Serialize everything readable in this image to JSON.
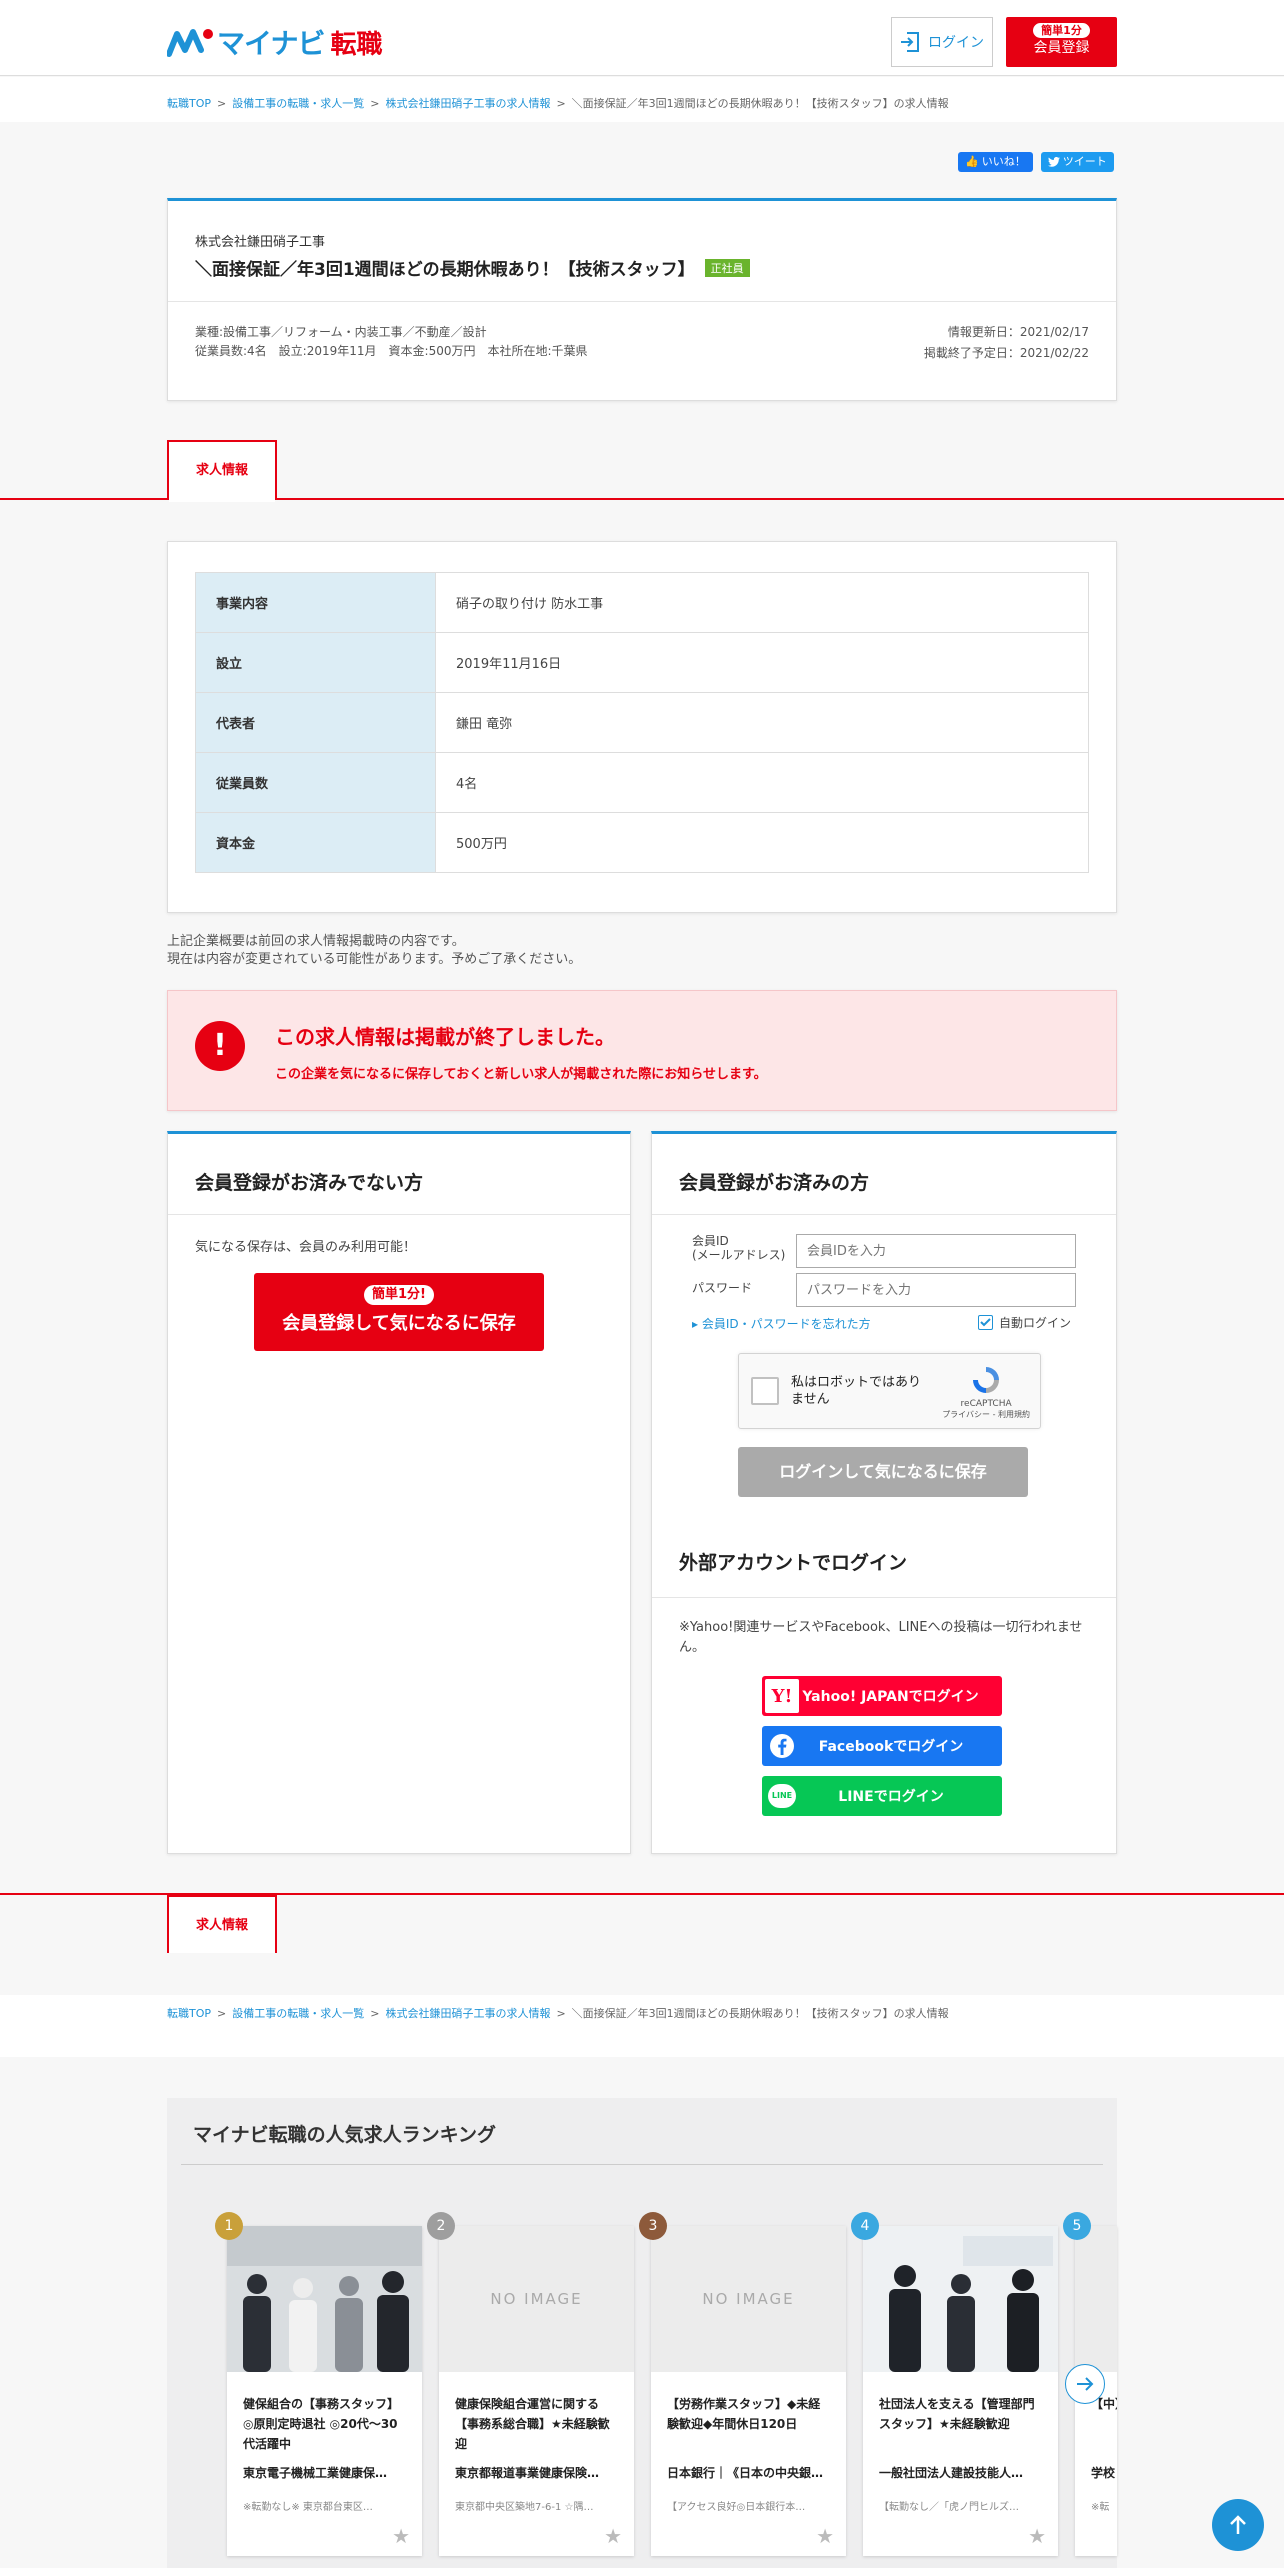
{
  "header": {
    "logo_text": "マイナビ",
    "logo_sub": "転職",
    "login_label": "ログイン",
    "register_pill": "簡単1分",
    "register_label": "会員登録"
  },
  "breadcrumb": {
    "items": [
      "転職TOP",
      "設備工事の転職・求人一覧",
      "株式会社鎌田硝子工事の求人情報"
    ],
    "current": "＼面接保証／年3回1週間ほどの長期休暇あり！【技術スタッフ】の求人情報",
    "sep": ">"
  },
  "social": {
    "like": "いいね！",
    "tweet": "ツイート"
  },
  "job": {
    "company": "株式会社鎌田硝子工事",
    "title": "＼面接保証／年3回1週間ほどの長期休暇あり！【技術スタッフ】",
    "badge": "正社員",
    "meta_line1": "業種:設備工事／リフォーム・内装工事／不動産／設計",
    "meta_line2": "従業員数:4名　設立:2019年11月　資本金:500万円　本社所在地:千葉県",
    "updated": "情報更新日：2021/02/17",
    "end_date": "掲載終了予定日：2021/02/22"
  },
  "tab": {
    "label": "求人情報"
  },
  "info": {
    "rows": [
      {
        "k": "事業内容",
        "v": "硝子の取り付け 防水工事"
      },
      {
        "k": "設立",
        "v": "2019年11月16日"
      },
      {
        "k": "代表者",
        "v": "鎌田 竜弥"
      },
      {
        "k": "従業員数",
        "v": "4名"
      },
      {
        "k": "資本金",
        "v": "500万円"
      }
    ]
  },
  "note": {
    "line1": "上記企業概要は前回の求人情報掲載時の内容です。",
    "line2": "現在は内容が変更されている可能性があります。予めご了承ください。"
  },
  "alert": {
    "icon": "!",
    "title": "この求人情報は掲載が終了しました。",
    "sub": "この企業を気になるに保存しておくと新しい求人が掲載された際にお知らせします。"
  },
  "left_panel": {
    "heading": "会員登録がお済みでない方",
    "text": "気になる保存は、会員のみ利用可能！",
    "btn_pill": "簡単1分!",
    "btn_label": "会員登録して気になるに保存"
  },
  "right_panel": {
    "heading": "会員登録がお済みの方",
    "id_label_1": "会員ID",
    "id_label_2": "(メールアドレス)",
    "id_placeholder": "会員IDを入力",
    "pw_label": "パスワード",
    "pw_placeholder": "パスワードを入力",
    "forgot": "▸ 会員ID・パスワードを忘れた方",
    "auto_login": "自動ログイン",
    "captcha_text_1": "私はロボットではあり",
    "captcha_text_2": "ません",
    "captcha_brand": "reCAPTCHA",
    "captcha_links": "プライバシー - 利用規約",
    "login_btn": "ログインして気になるに保存",
    "ext_heading": "外部アカウントでログイン",
    "ext_note": "※Yahoo!関連サービスやFacebook、LINEへの投稿は一切行われません。",
    "yahoo": "Yahoo! JAPANでログイン",
    "facebook": "Facebookでログイン",
    "line": "LINEでログイン",
    "line_icon_text": "LINE"
  },
  "colors": {
    "brand_blue": "#1e92d6",
    "brand_red": "#e60012",
    "yahoo": "#ff0033",
    "facebook": "#1877f2",
    "line": "#06c755"
  },
  "ranking": {
    "heading": "マイナビ転職の人気求人ランキング",
    "no_image": "NO IMAGE",
    "items": [
      {
        "rank": "1",
        "title": "健保組合の【事務スタッフ】◎原則定時退社 ◎20代～30代活躍中",
        "company": "東京電子機械工業健康保…",
        "location": "※転勤なし※ 東京都台東区…",
        "color": "#c9a03a"
      },
      {
        "rank": "2",
        "title": "健康保険組合運営に関する【事務系総合職】★未経験歓迎",
        "company": "東京都報道事業健康保険…",
        "location": "東京都中央区築地7-6-1 ☆隅…",
        "color": "#9e9e9e"
      },
      {
        "rank": "3",
        "title": "【労務作業スタッフ】◆未経験歓迎◆年間休日120日",
        "company": "日本銀行｜《日本の中央銀…",
        "location": "【アクセス良好◎日本銀行本…",
        "color": "#8d5a3b"
      },
      {
        "rank": "4",
        "title": "社団法人を支える【管理部門スタッフ】★未経験歓迎",
        "company": "一般社団法人建設技能人…",
        "location": "【転勤なし／「虎ノ門ヒルズ…",
        "color": "#3aa8e0"
      },
      {
        "rank": "5",
        "title": "【中】募集",
        "company": "学校",
        "location": "※転",
        "color": "#3aa8e0"
      }
    ]
  }
}
